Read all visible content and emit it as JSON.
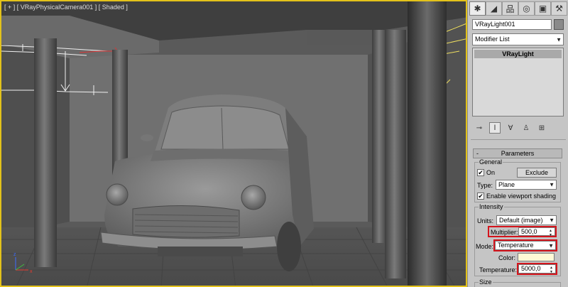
{
  "viewport": {
    "label": "[ + ] [ VRayPhysicalCamera001 ] [ Shaded ]",
    "border_color": "#e3c21a"
  },
  "tabs": [
    {
      "name": "create-tab",
      "icon": "star-icon",
      "glyph": "✱"
    },
    {
      "name": "modify-tab",
      "icon": "modify-icon",
      "glyph": "◢"
    },
    {
      "name": "hierarchy-tab",
      "icon": "hierarchy-icon",
      "glyph": "品"
    },
    {
      "name": "motion-tab",
      "icon": "motion-icon",
      "glyph": "◎"
    },
    {
      "name": "display-tab",
      "icon": "display-icon",
      "glyph": "▣"
    },
    {
      "name": "utilities-tab",
      "icon": "hammer-icon",
      "glyph": "⚒"
    }
  ],
  "object": {
    "name": "VRayLight001",
    "color": "#8a8a8a"
  },
  "modifier_list": {
    "label": "Modifier List"
  },
  "stack": {
    "item": "VRayLight"
  },
  "stack_tools": [
    {
      "name": "pin-stack-icon",
      "glyph": "⊸"
    },
    {
      "name": "show-end-result-icon",
      "glyph": "Ⅰ"
    },
    {
      "name": "make-unique-icon",
      "glyph": "∀"
    },
    {
      "name": "remove-modifier-icon",
      "glyph": "♙"
    },
    {
      "name": "configure-modifier-sets-icon",
      "glyph": "⊞"
    }
  ],
  "parameters": {
    "rollout_title": "Parameters",
    "rollout_toggle": "-",
    "general": {
      "title": "General",
      "on_label": "On",
      "on_checked": "✔",
      "exclude_label": "Exclude",
      "type_label": "Type:",
      "type_value": "Plane",
      "viewport_shading_label": "Enable viewport shading",
      "viewport_shading_checked": "✔"
    },
    "intensity": {
      "title": "Intensity",
      "units_label": "Units:",
      "units_value": "Default (image)",
      "multiplier_label": "Multiplier:",
      "multiplier_value": "500,0",
      "mode_label": "Mode:",
      "mode_value": "Temperature",
      "color_label": "Color:",
      "color_value": "#fff9d6",
      "temperature_label": "Temperature:",
      "temperature_value": "5000,0"
    },
    "size": {
      "title": "Size"
    }
  },
  "highlight_color": "#d4141c"
}
